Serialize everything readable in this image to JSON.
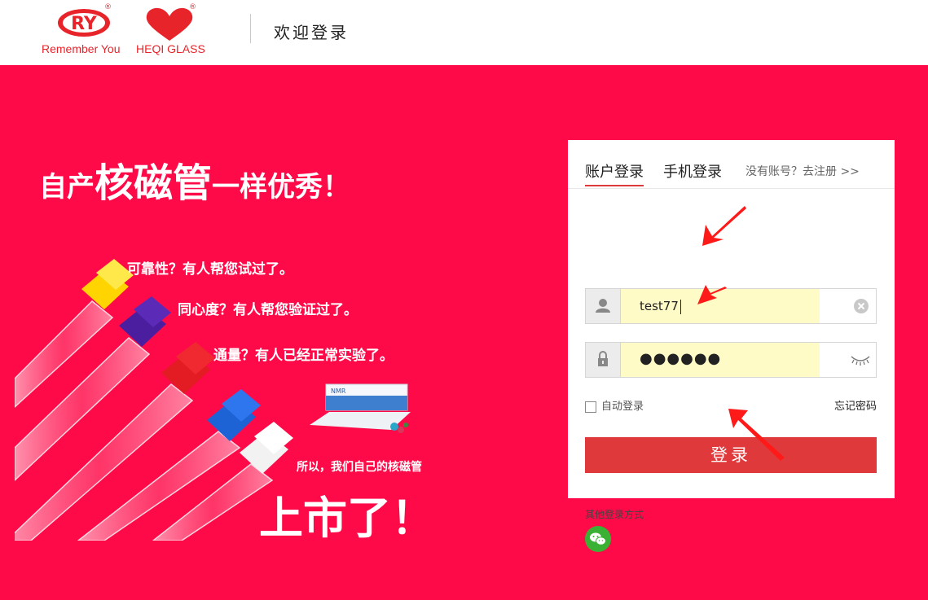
{
  "header": {
    "logo_ry": "RY",
    "logo_ry_caption": "Remember You",
    "logo_heqi_caption": "HEQI GLASS",
    "reg_mark": "®",
    "welcome": "欢迎登录"
  },
  "promo": {
    "tagline_1": "自产",
    "tagline_2": "核磁管",
    "tagline_3": "一样优秀！",
    "q1": "可靠性？有人帮您试过了。",
    "q2": "同心度？有人帮您验证过了。",
    "q3": "通量？有人已经正常实验了。",
    "box_label": "NMR",
    "small_line": "所以，我们自己的核磁管",
    "big_line": "上市了！"
  },
  "login": {
    "tab_account": "账户登录",
    "tab_phone": "手机登录",
    "register_link": "没有账号？去注册 >>",
    "username_value": "test77",
    "password_value": "●●●●●●",
    "remember_label": "自动登录",
    "forgot_label": "忘记密码",
    "submit_label": "登录",
    "other_methods": "其他登录方式"
  },
  "colors": {
    "banner": "#ff0a48",
    "brand_red": "#e8242b",
    "button": "#e0393b",
    "autofill": "#fefbc6",
    "wechat": "#3ab135"
  },
  "icons": [
    "ry-logo",
    "heart-logo",
    "user-icon",
    "lock-icon",
    "clear-icon",
    "eye-closed-icon",
    "wechat-icon",
    "arrow-annotation"
  ]
}
